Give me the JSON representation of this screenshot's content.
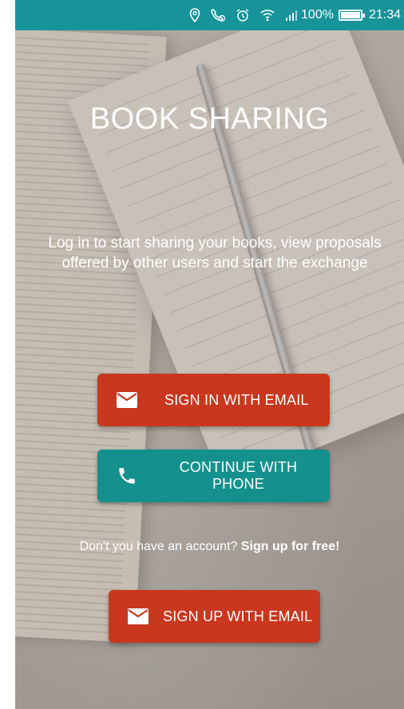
{
  "status_bar": {
    "battery": "100%",
    "time": "21:34",
    "icons": [
      "location-icon",
      "phone-call-icon",
      "alarm-icon",
      "wifi-icon",
      "signal-icon",
      "battery-icon"
    ]
  },
  "app": {
    "title": "BOOK SHARING",
    "subtitle": "Log in to start sharing your books, view proposals offered by other users and start the exchange"
  },
  "buttons": {
    "sign_in_email": "SIGN IN WITH EMAIL",
    "continue_phone": "CONTINUE WITH PHONE",
    "sign_up_email": "SIGN UP WITH EMAIL"
  },
  "signup": {
    "prompt": "Don't you have an account?",
    "link": "Sign up for free!"
  },
  "colors": {
    "status_bar": "#17939a",
    "email_button": "#c8371e",
    "phone_button": "#14918d"
  }
}
